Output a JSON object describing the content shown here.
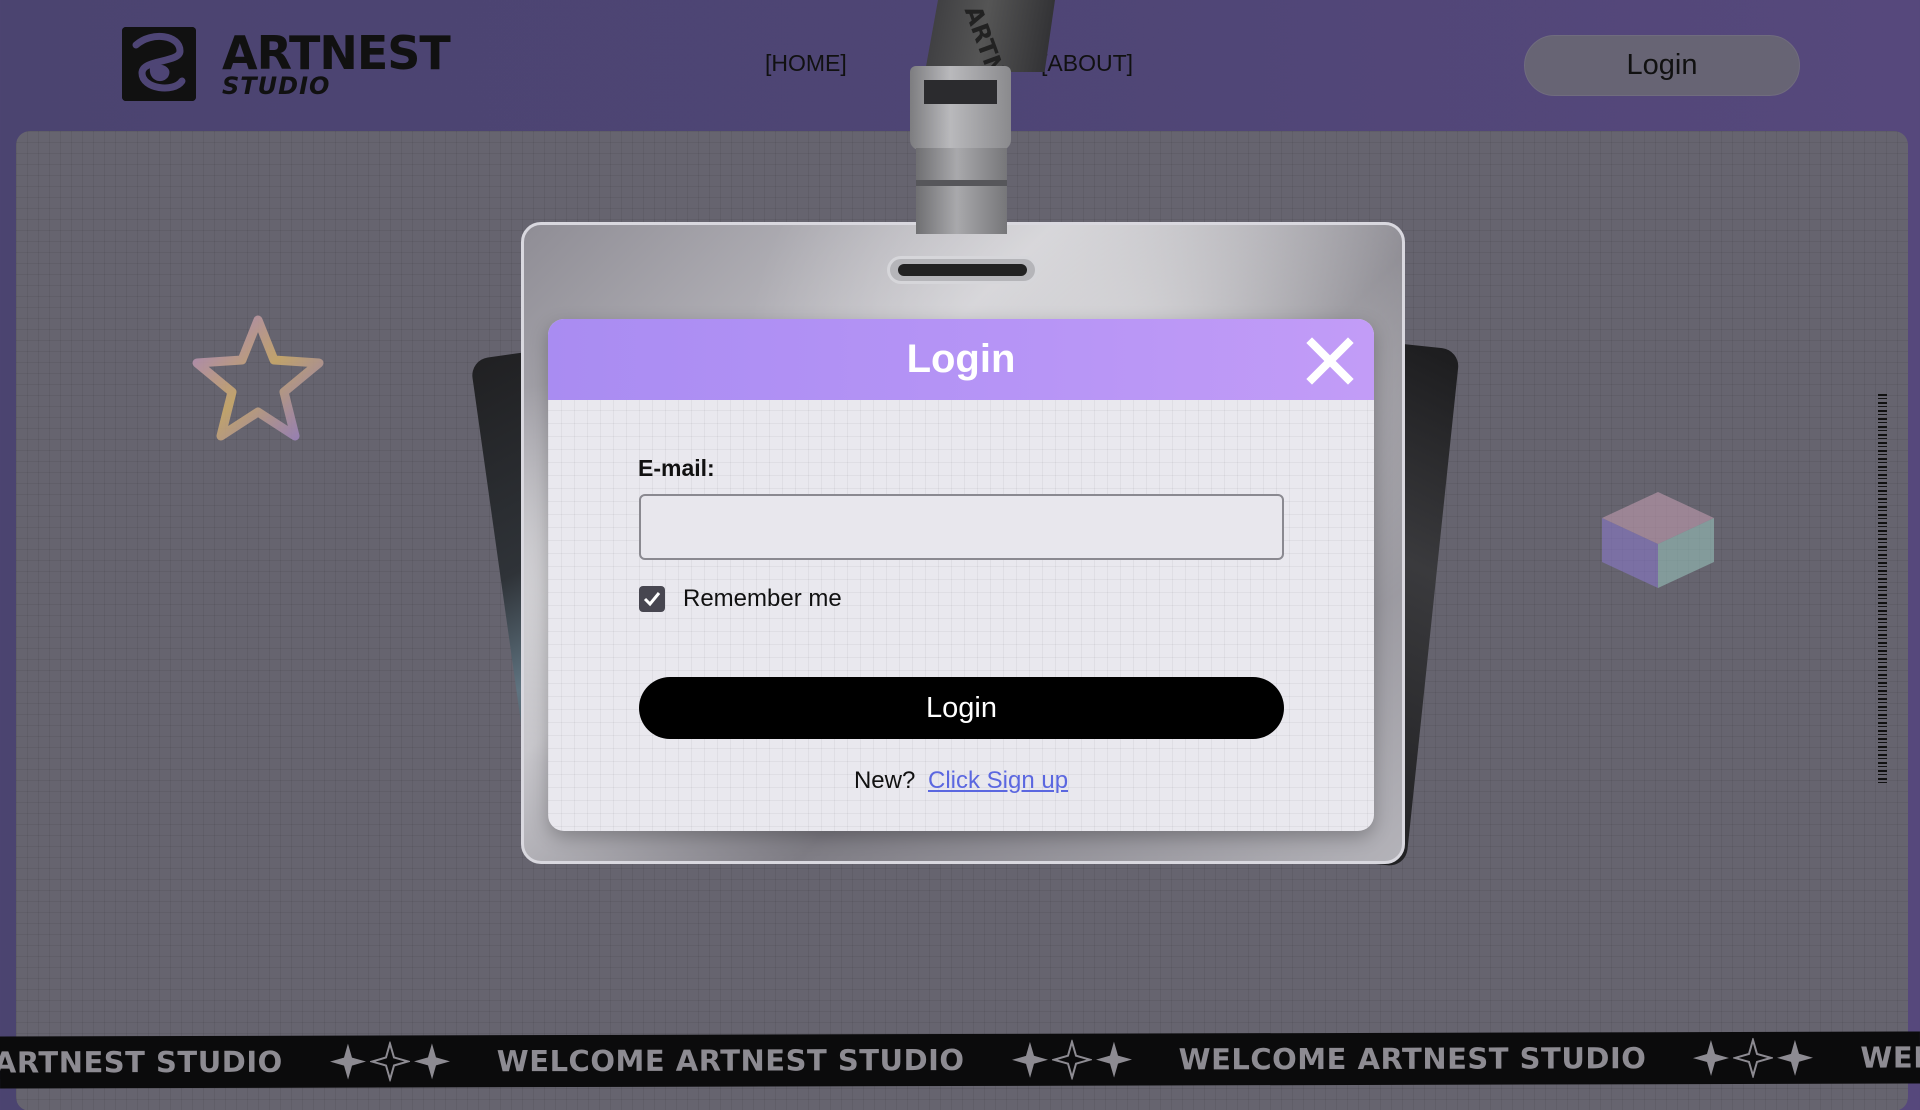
{
  "brand": {
    "name": "ARTNEST",
    "subtitle": "STUDIO",
    "strap_text": "ARTN"
  },
  "nav": {
    "home": "[HOME]",
    "about": "[ABOUT]",
    "login_button": "Login"
  },
  "modal": {
    "title": "Login",
    "email_label": "E-mail:",
    "email_value": "",
    "remember_label": "Remember me",
    "remember_checked": true,
    "submit_label": "Login",
    "signup_prompt": "New?",
    "signup_link": "Click Sign up"
  },
  "marquee": {
    "items": [
      "E ARTNEST STUDIO",
      "WELCOME ARTNEST STUDIO",
      "WELCOME ARTNEST STUDIO",
      "WELC"
    ]
  },
  "colors": {
    "background": "#4e4575",
    "panel": "#66646f",
    "modal_header": "#b795f6",
    "link": "#5b67e0",
    "button": "#000000"
  },
  "icons": [
    "logo-mark-icon",
    "close-icon",
    "checkmark-icon",
    "star-outline-icon",
    "cube-icon",
    "sparkle-star-icon"
  ]
}
